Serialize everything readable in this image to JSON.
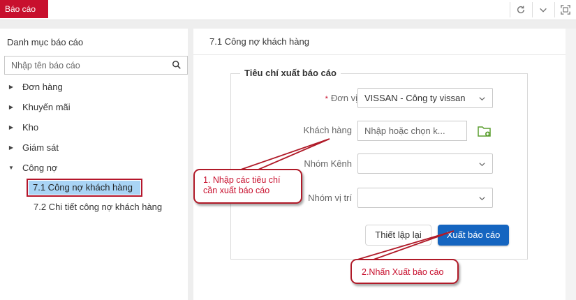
{
  "topbar": {
    "tab_label": "Báo cáo",
    "icons": [
      "refresh-icon",
      "chevron-down-icon",
      "fullscreen-icon"
    ]
  },
  "sidebar": {
    "title": "Danh mục báo cáo",
    "search_placeholder": "Nhập tên báo cáo",
    "items": [
      {
        "label": "Đơn hàng",
        "expanded": false
      },
      {
        "label": "Khuyến mãi",
        "expanded": false
      },
      {
        "label": "Kho",
        "expanded": false
      },
      {
        "label": "Giám sát",
        "expanded": false
      },
      {
        "label": "Công nợ",
        "expanded": true
      }
    ],
    "subitems": [
      {
        "label": "7.1 Công nợ khách hàng",
        "active": true
      },
      {
        "label": "7.2 Chi tiết công nợ khách hàng",
        "active": false
      }
    ]
  },
  "main": {
    "title": "7.1 Công nợ khách hàng",
    "form": {
      "legend": "Tiêu chí xuất báo cáo",
      "unit_label": "Đơn vị",
      "unit_required_mark": "*",
      "unit_value": "VISSAN - Công ty vissan",
      "customer_label": "Khách hàng",
      "customer_placeholder": "Nhập hoặc chọn k...",
      "channel_group_label": "Nhóm Kênh",
      "channel_group_value": "",
      "location_group_label": "Nhóm vị trí",
      "location_group_value": "",
      "reset_button": "Thiết lập lại",
      "export_button": "Xuất báo cáo"
    }
  },
  "annotations": {
    "callout_1_line1": "1. Nhập các tiêu chí",
    "callout_1_line2": "cần xuất báo cáo",
    "callout_2": "2.Nhấn Xuất báo cáo"
  },
  "colors": {
    "brand_red": "#c8102e",
    "primary_blue": "#1565c0",
    "active_item_bg": "#a9d4f5",
    "folder_icon_green": "#5a9e2f"
  }
}
